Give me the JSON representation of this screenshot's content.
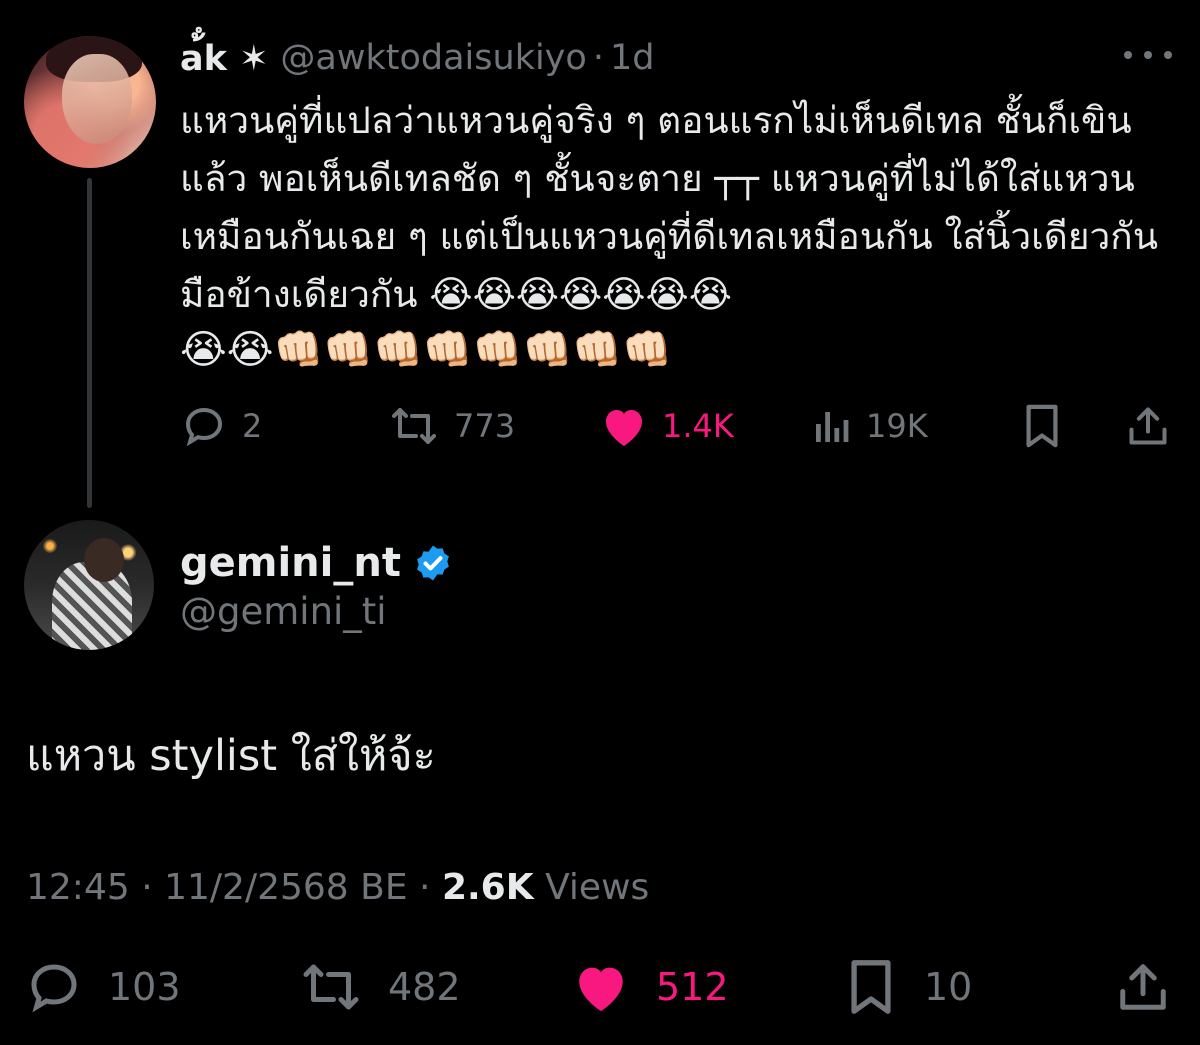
{
  "parent_tweet": {
    "display_name": "a้ํk ✶",
    "handle": "@awktodaisukiyo",
    "separator": "·",
    "time": "1d",
    "text": "แหวนคู่ที่แปลว่าแหวนคู่จริง ๆ ตอนแรกไม่เห็นดีเทล ชั้นก็เขินแล้ว พอเห็นดีเทลชัด ๆ ชั้นจะตาย ┬┬ แหวนคู่ที่ไม่ได้ใส่แหวนเหมือนกันเฉย ๆ แต่เป็นแหวนคู่ที่ดีเทลเหมือนกัน ใส่นิ้วเดียวกัน มือข้างเดียวกัน 😭😭😭😭😭😭😭",
    "emoji_line": "😭😭👊🏻👊🏻👊🏻👊🏻👊🏻👊🏻👊🏻👊🏻",
    "actions": {
      "replies": "2",
      "reposts": "773",
      "likes": "1.4K",
      "views": "19K"
    },
    "icons": [
      "reply-icon",
      "repost-icon",
      "heart-icon",
      "views-icon",
      "bookmark-icon",
      "share-icon",
      "more-icon"
    ]
  },
  "main_tweet": {
    "display_name": "gemini_nt",
    "handle": "@gemini_ti",
    "text": "แหวน stylist ใส่ให้จ้ะ",
    "timestamp": "12:45",
    "date": "11/2/2568 BE",
    "separator": "·",
    "views_count": "2.6K",
    "views_label": "Views",
    "actions": {
      "replies": "103",
      "reposts": "482",
      "likes": "512",
      "bookmarks": "10"
    }
  },
  "colors": {
    "background": "#000000",
    "text": "#e7e9ea",
    "muted": "#71767b",
    "like": "#f91880",
    "verified": "#1d9bf0"
  }
}
